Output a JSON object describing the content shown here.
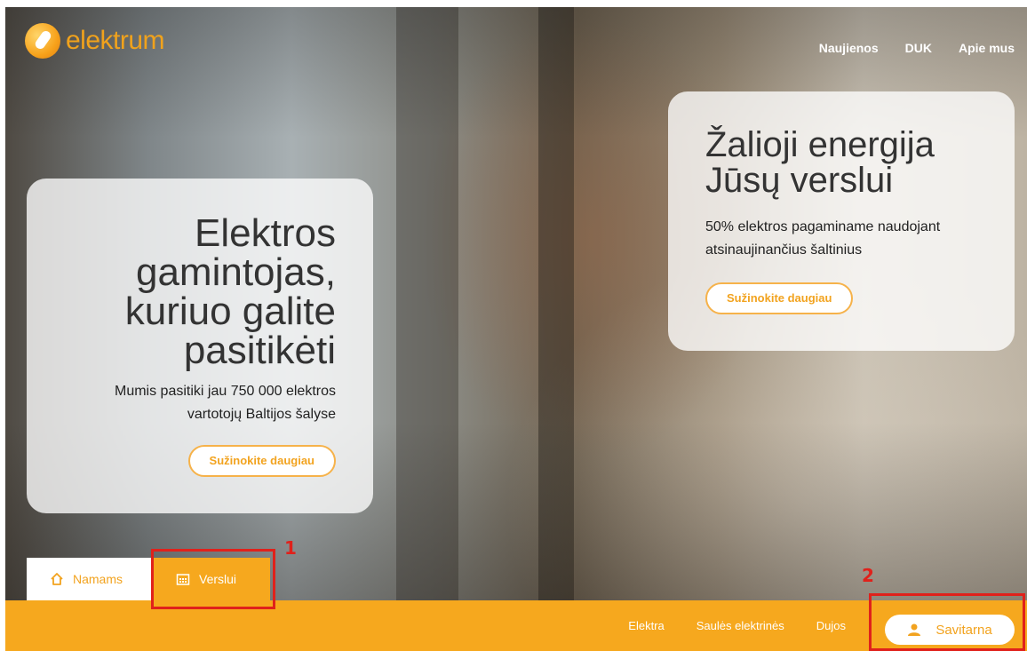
{
  "brand": {
    "name": "elektrum"
  },
  "top_nav": [
    "Naujienos",
    "DUK",
    "Apie mus"
  ],
  "hero_left": {
    "title_lines": [
      "Elektros",
      "gamintojas,",
      "kuriuo galite",
      "pasitikėti"
    ],
    "text_lines": [
      "Mumis pasitiki jau 750 000 elektros",
      "vartotojų Baltijos šalyse"
    ],
    "button": "Sužinokite daugiau"
  },
  "hero_right": {
    "title_lines": [
      "Žalioji energija",
      "Jūsų verslui"
    ],
    "text_lines": [
      "50% elektros pagaminame naudojant",
      "atsinaujinančius šaltinius"
    ],
    "button": "Sužinokite daugiau"
  },
  "tabs": [
    {
      "label": "Namams",
      "icon": "home-icon"
    },
    {
      "label": "Verslui",
      "icon": "calendar-icon"
    }
  ],
  "bottom_nav": [
    "Elektra",
    "Saulės elektrinės",
    "Dujos"
  ],
  "self_service_button": {
    "label": "Savitarna",
    "icon": "user-icon"
  },
  "annotations": [
    "1",
    "2"
  ],
  "colors": {
    "accent": "#f6a81e",
    "annotation": "#e0211b"
  }
}
